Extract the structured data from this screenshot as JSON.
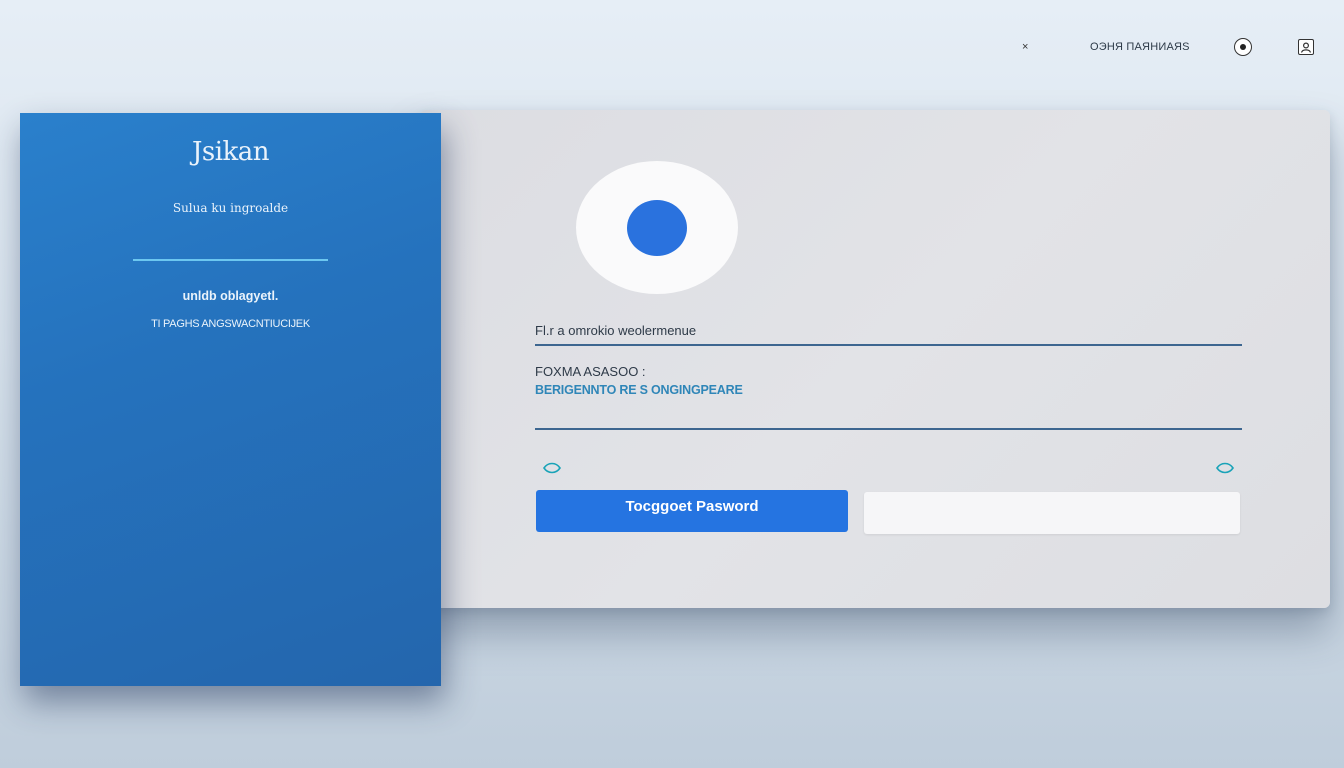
{
  "topbar": {
    "close_glyph": "×",
    "label": "ОЭНЯ ПАЯНИАЯS",
    "icons": [
      "close-icon",
      "record-icon",
      "user-icon"
    ]
  },
  "left_panel": {
    "title": "Jsikan",
    "subtitle": "Sulua ku ingroalde",
    "heading": "unldb oblagyetl.",
    "subtext": "TI PAGHS ANGSWACNTIUCIJEK",
    "background_color": "#2572bd",
    "divider_color": "#6cc7f0"
  },
  "form": {
    "field1_label": "Fl.r a omrokio weolermenue",
    "field2_label": "FOXMA ASASOO :",
    "field2_hint": "BERIGENNTO RE S ONGINGPEARE",
    "primary_button": "Tocggoet Pasword",
    "secondary_button": "",
    "accent_color": "#2574e1",
    "line_color": "#3d6690"
  }
}
